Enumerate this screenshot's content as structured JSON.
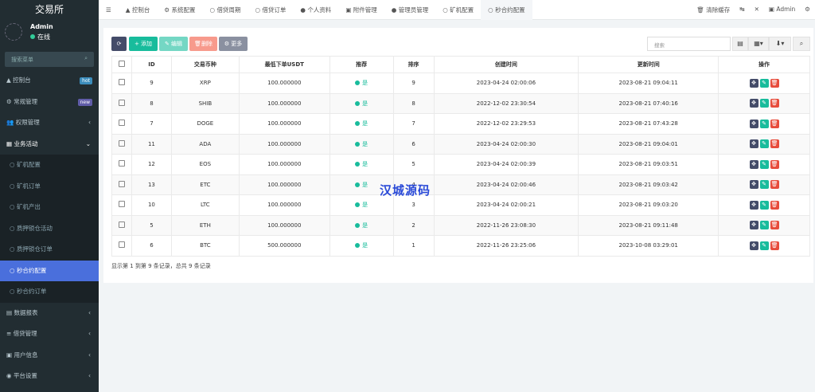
{
  "sidebar": {
    "logo": "交易所",
    "user": {
      "name": "Admin",
      "status": "在线"
    },
    "search_placeholder": "搜索菜单",
    "items": [
      {
        "label": "控制台",
        "badge": "hot",
        "badge_color": "#3c8dbc"
      },
      {
        "label": "常规管理",
        "badge": "new",
        "badge_color": "#605ca8"
      },
      {
        "label": "权限管理"
      },
      {
        "label": "业务活动"
      }
    ],
    "sub": [
      {
        "label": "矿机配置"
      },
      {
        "label": "矿机订单"
      },
      {
        "label": "矿机产出"
      },
      {
        "label": "质押锁仓活动"
      },
      {
        "label": "质押锁仓订单"
      },
      {
        "label": "秒合约配置",
        "active": true
      },
      {
        "label": "秒合约订单"
      }
    ],
    "items2": [
      {
        "label": "数据报表"
      },
      {
        "label": "借贷管理"
      },
      {
        "label": "用户信息"
      },
      {
        "label": "平台设置"
      }
    ]
  },
  "topbar": {
    "tabs": [
      {
        "icon": "dashboard-icon",
        "label": "控制台"
      },
      {
        "icon": "gear-icon",
        "label": "系统配置"
      },
      {
        "icon": "circle-icon",
        "label": "借贷周期"
      },
      {
        "icon": "circle-icon",
        "label": "借贷订单"
      },
      {
        "icon": "user-icon",
        "label": "个人资料"
      },
      {
        "icon": "file-image-icon",
        "label": "附件管理"
      },
      {
        "icon": "user-icon",
        "label": "管理员管理"
      },
      {
        "icon": "circle-icon",
        "label": "矿机配置"
      },
      {
        "icon": "circle-icon",
        "label": "秒合约配置",
        "active": true
      }
    ],
    "clear_cache": "清除缓存",
    "admin": "Admin"
  },
  "toolbar": {
    "add": "添加",
    "edit": "编辑",
    "delete": "删除",
    "more": "更多",
    "search_placeholder": "搜索"
  },
  "table": {
    "headers": [
      "ID",
      "交易币种",
      "最低下单USDT",
      "推荐",
      "排序",
      "创建时间",
      "更新时间",
      "操作"
    ],
    "rows": [
      [
        "9",
        "XRP",
        "100.000000",
        "是",
        "9",
        "2023-04-24 02:00:06",
        "2023-08-21 09:04:11"
      ],
      [
        "8",
        "SHIB",
        "100.000000",
        "是",
        "8",
        "2022-12-02 23:30:54",
        "2023-08-21 07:40:16"
      ],
      [
        "7",
        "DOGE",
        "100.000000",
        "是",
        "7",
        "2022-12-02 23:29:53",
        "2023-08-21 07:43:28"
      ],
      [
        "11",
        "ADA",
        "100.000000",
        "是",
        "6",
        "2023-04-24 02:00:30",
        "2023-08-21 09:04:01"
      ],
      [
        "12",
        "EOS",
        "100.000000",
        "是",
        "5",
        "2023-04-24 02:00:39",
        "2023-08-21 09:03:51"
      ],
      [
        "13",
        "ETC",
        "100.000000",
        "是",
        "4",
        "2023-04-24 02:00:46",
        "2023-08-21 09:03:42"
      ],
      [
        "10",
        "LTC",
        "100.000000",
        "是",
        "3",
        "2023-04-24 02:00:21",
        "2023-08-21 09:03:20"
      ],
      [
        "5",
        "ETH",
        "100.000000",
        "是",
        "2",
        "2022-11-26 23:08:30",
        "2023-08-21 09:11:48"
      ],
      [
        "6",
        "BTC",
        "500.000000",
        "是",
        "1",
        "2022-11-26 23:25:06",
        "2023-10-08 03:29:01"
      ]
    ]
  },
  "footer": "显示第 1 到第 9 条记录，总共 9 条记录",
  "watermark": "汉城源码"
}
